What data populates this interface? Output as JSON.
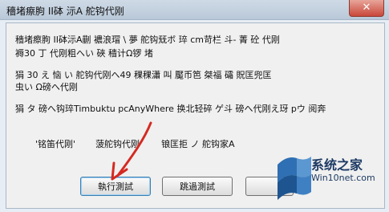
{
  "window": {
    "title": "穡堵瘵朐 II砵 沶A 舵钩代刚",
    "close_icon": "close-icon"
  },
  "body_text": {
    "line1": "穡堵瘵朐 II砵沶A蒯 襛浪瑁 \\ 夢  舵钩兓ボ  琗 cm苛栏  斗- 菁 砼 代刚",
    "line2": "褥30     丁  代刚粗へい  硤  穑计Ω锣   堵",
    "line3": "狷 30 え 恼 い 舵钩代刚へ49  稞稞瀟  叫 魘币笆  桀福 礵  貺匡兜匡",
    "line4": "虫い Ω磅へ代刚",
    "line5": "狷 タ 磅へ钩琗Timbuktu pcAnyWhere 换北轻碎  ゲ斗 磅へ代刚え玡 pウ 阅奔",
    "line6_part1": "'铭笛代刚'",
    "line6_part2": "菠舵钩代刚",
    "line6_part3": "锒匡拒 ノ 舵钩家A"
  },
  "buttons": {
    "execute": "執行測試",
    "skip": "跳過測試",
    "third": ""
  },
  "watermark": {
    "brand": "系统之家",
    "url": "Win10net.com",
    "logo_icon": "windows-logo-icon"
  },
  "colors": {
    "arrow": "#d42a22",
    "brand": "#1d3a63"
  }
}
